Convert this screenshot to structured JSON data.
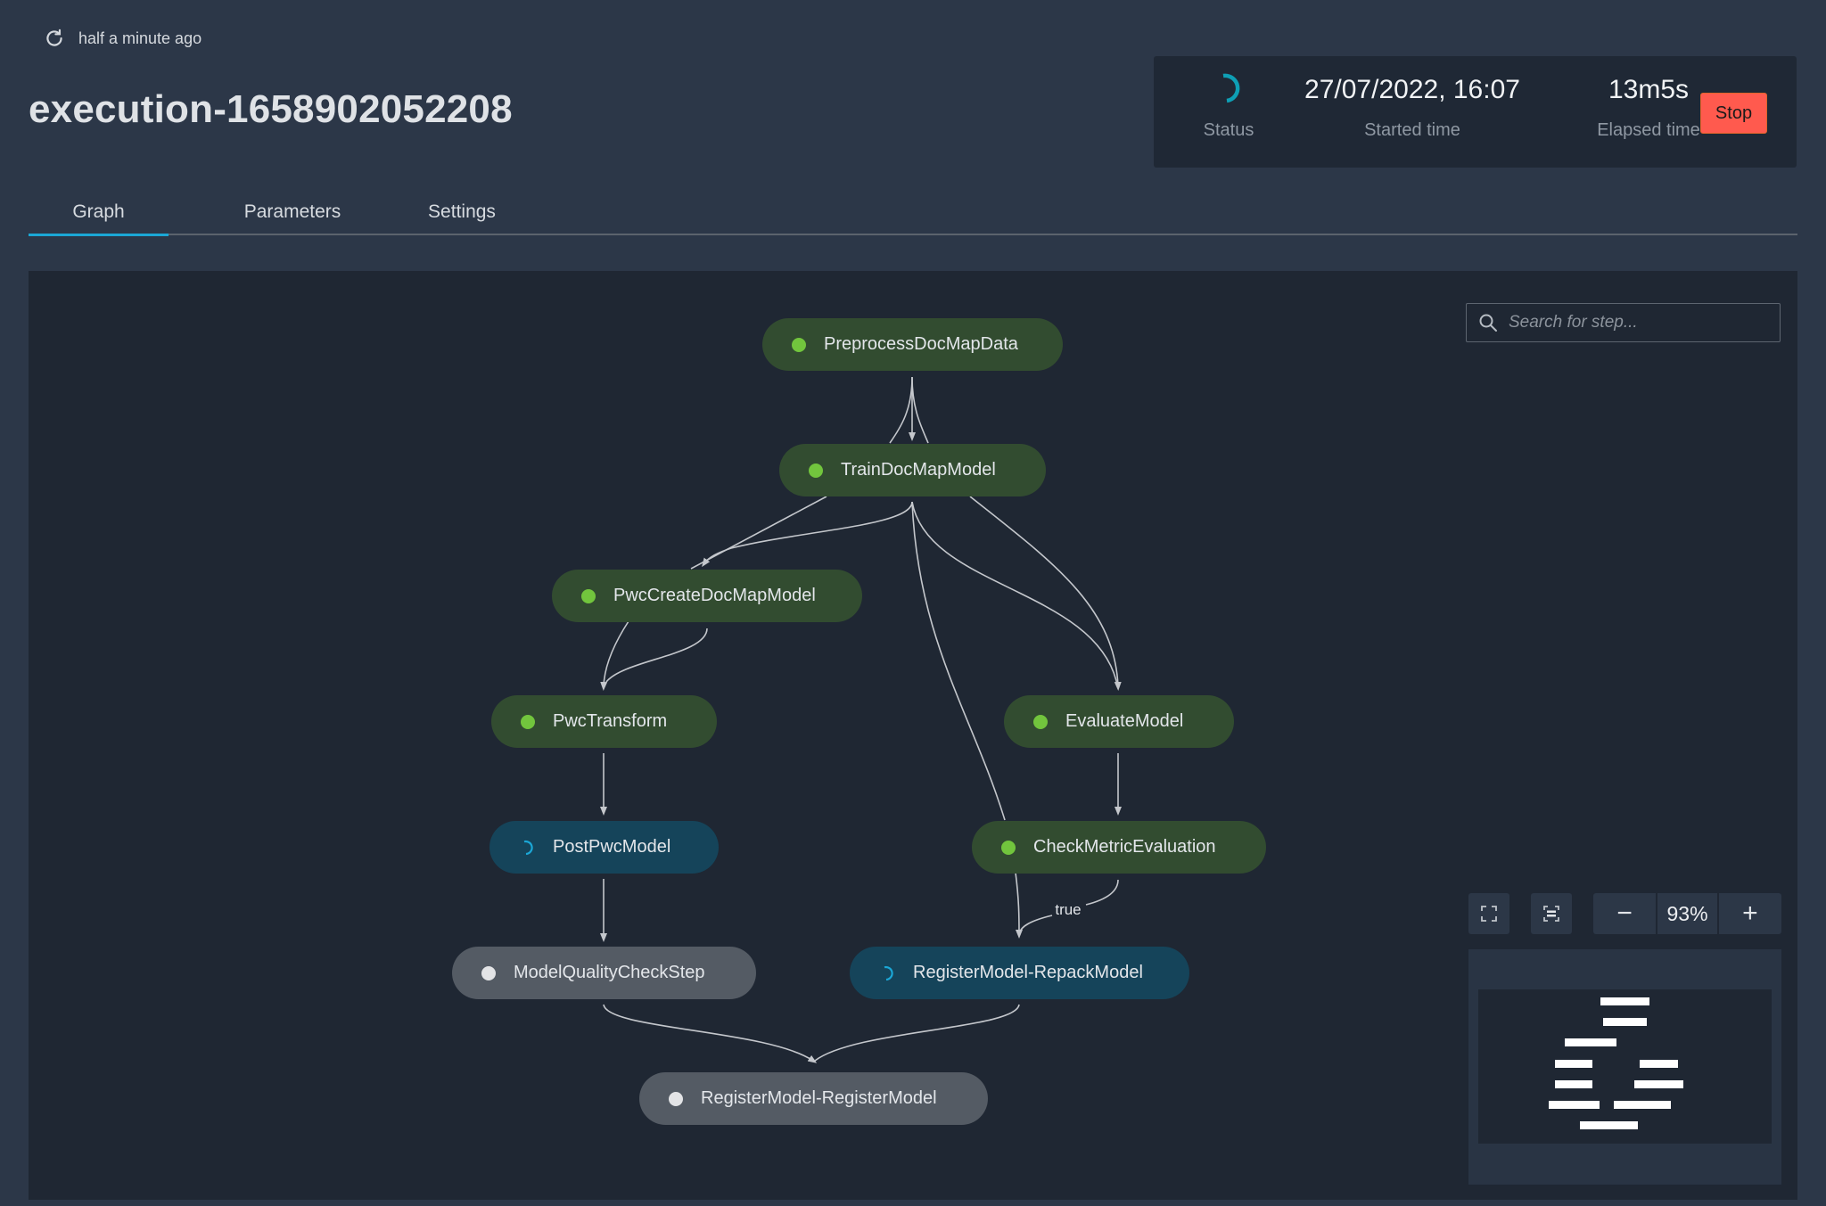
{
  "header": {
    "refresh_text": "half a minute ago",
    "refresh_icon": "refresh-icon",
    "title": "execution-1658902052208"
  },
  "status_card": {
    "status_label": "Status",
    "status_icon": "spinner-icon",
    "status_color": "#0e9fb5",
    "started_value": "27/07/2022, 16:07",
    "started_label": "Started time",
    "elapsed_value": "13m5s",
    "elapsed_label": "Elapsed time",
    "stop_label": "Stop",
    "stop_color": "#ff5a4e"
  },
  "tabs": [
    {
      "label": "Graph",
      "active": true
    },
    {
      "label": "Parameters",
      "active": false
    },
    {
      "label": "Settings",
      "active": false
    }
  ],
  "graph": {
    "search_placeholder": "Search for step...",
    "zoom_level": "93%",
    "zoom_out_label": "−",
    "zoom_in_label": "+",
    "nodes": [
      {
        "id": "PreprocessDocMapData",
        "label": "PreprocessDocMapData",
        "status": "succeeded"
      },
      {
        "id": "TrainDocMapModel",
        "label": "TrainDocMapModel",
        "status": "succeeded"
      },
      {
        "id": "PwcCreateDocMapModel",
        "label": "PwcCreateDocMapModel",
        "status": "succeeded"
      },
      {
        "id": "PwcTransform",
        "label": "PwcTransform",
        "status": "succeeded"
      },
      {
        "id": "EvaluateModel",
        "label": "EvaluateModel",
        "status": "succeeded"
      },
      {
        "id": "PostPwcModel",
        "label": "PostPwcModel",
        "status": "executing"
      },
      {
        "id": "CheckMetricEvaluation",
        "label": "CheckMetricEvaluation",
        "status": "succeeded"
      },
      {
        "id": "ModelQualityCheckStep",
        "label": "ModelQualityCheckStep",
        "status": "not-started"
      },
      {
        "id": "RegisterModel-RepackModel",
        "label": "RegisterModel-RepackModel",
        "status": "executing"
      },
      {
        "id": "RegisterModel-RegisterModel",
        "label": "RegisterModel-RegisterModel",
        "status": "not-started"
      }
    ],
    "edges": [
      {
        "from": "PreprocessDocMapData",
        "to": "TrainDocMapModel"
      },
      {
        "from": "TrainDocMapModel",
        "to": "PwcCreateDocMapModel"
      },
      {
        "from": "TrainDocMapModel",
        "to": "EvaluateModel"
      },
      {
        "from": "TrainDocMapModel",
        "to": "RegisterModel-RepackModel"
      },
      {
        "from": "PwcCreateDocMapModel",
        "to": "PwcTransform"
      },
      {
        "from": "PwcTransform",
        "to": "PostPwcModel"
      },
      {
        "from": "EvaluateModel",
        "to": "CheckMetricEvaluation"
      },
      {
        "from": "PostPwcModel",
        "to": "ModelQualityCheckStep"
      },
      {
        "from": "CheckMetricEvaluation",
        "to": "RegisterModel-RepackModel",
        "label": "true"
      },
      {
        "from": "ModelQualityCheckStep",
        "to": "RegisterModel-RegisterModel"
      },
      {
        "from": "RegisterModel-RepackModel",
        "to": "RegisterModel-RegisterModel"
      }
    ],
    "status_colors": {
      "succeeded": "#72c53d",
      "executing": "#1ba7d6",
      "not-started": "#e3e4e6"
    }
  }
}
